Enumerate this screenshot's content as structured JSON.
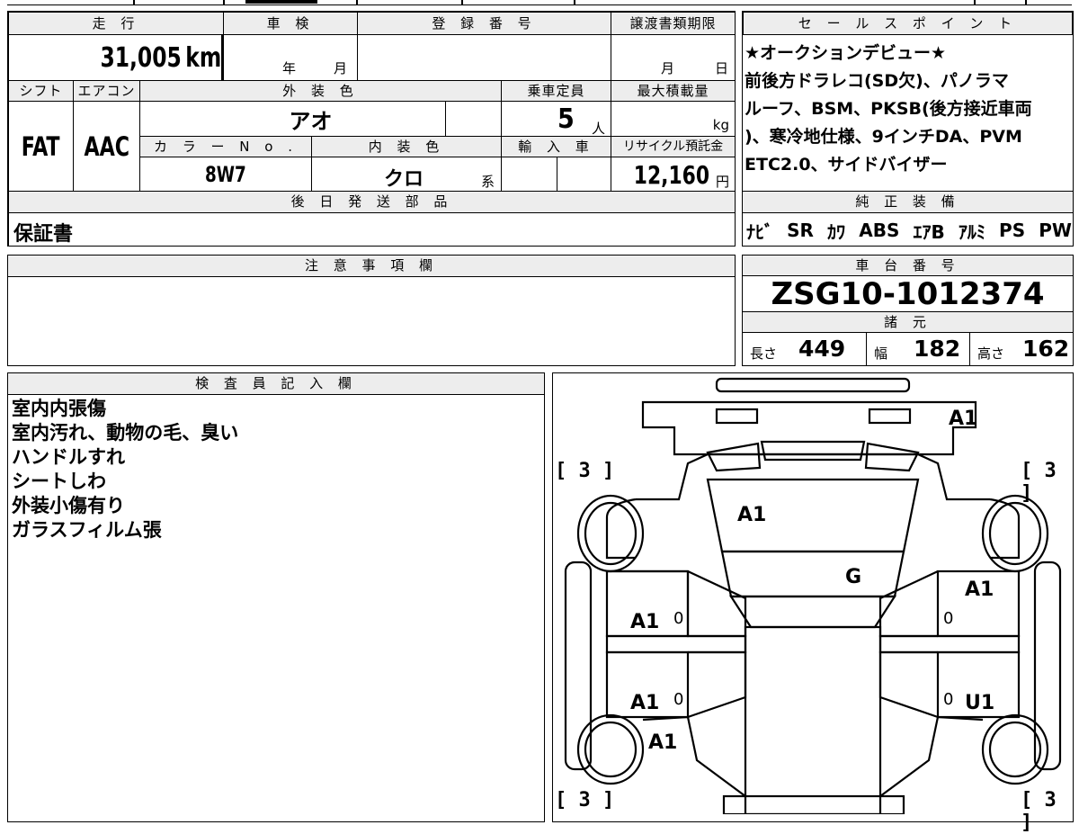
{
  "vehicle": {
    "mileage_header": "走 行",
    "mileage": "31,005",
    "mileage_unit": "km",
    "inspection_header": "車 検",
    "inspection_year_label": "年",
    "inspection_month_label": "月",
    "registration_header": "登 録 番 号",
    "transfer_header": "譲渡書類期限",
    "transfer_month_label": "月",
    "transfer_day_label": "日",
    "shift_header": "シフト",
    "shift": "FAT",
    "ac_header": "エアコン",
    "ac": "AAC",
    "exterior_color_header": "外 装 色",
    "exterior_color": "アオ",
    "capacity_header": "乗車定員",
    "capacity": "5",
    "capacity_unit": "人",
    "max_load_header": "最大積載量",
    "max_load_unit": "kg",
    "color_no_header": "カ ラ ー N o .",
    "color_no": "8W7",
    "interior_color_header": "内 装 色",
    "interior_color": "クロ",
    "interior_suffix": "系",
    "import_header": "輸 入 車",
    "recycle_header": "リサイクル預託金",
    "recycle_fee": "12,160",
    "recycle_unit": "円",
    "parts_header": "後 日 発 送 部 品",
    "parts": "保証書"
  },
  "sales_points": {
    "header": "セ ー ル ス ポ イ ン ト",
    "lines": [
      "★オークションデビュー★",
      "前後方ドラレコ(SD欠)、パノラマ",
      "ルーフ、BSM、PKSB(後方接近車両",
      ")、寒冷地仕様、9インチDA、PVM",
      "ETC2.0、サイドバイザー"
    ]
  },
  "equipment": {
    "header": "純 正 装 備",
    "items": [
      "ﾅﾋﾞ",
      "SR",
      "ｶﾜ",
      "ABS",
      "ｴｱB",
      "ｱﾙﾐ",
      "PS",
      "PW"
    ]
  },
  "notes": {
    "header": "注 意 事 項 欄"
  },
  "chassis": {
    "header": "車 台 番 号",
    "number": "ZSG10-1012374",
    "spec_header": "諸 元",
    "length_label": "長さ",
    "length": "449",
    "width_label": "幅",
    "width": "182",
    "height_label": "高さ",
    "height": "162"
  },
  "inspector": {
    "header": "検 査 員 記 入 欄",
    "remarks": [
      "室内内張傷",
      "室内汚れ、動物の毛、臭い",
      "ハンドルすれ",
      "シートしわ",
      "外装小傷有り",
      "ガラスフィルム張"
    ]
  },
  "diagram": {
    "tire_tl": "[ 3 ]",
    "tire_tr": "[ 3 ]",
    "tire_bl": "[ 3 ]",
    "tire_br": "[ 3 ]",
    "mark_rear": "A1",
    "mark_roof": "A1",
    "mark_glass": "G",
    "mark_right_front_door": "A1",
    "mark_left_front_door": "A1",
    "mark_left_rear_door": "A1",
    "mark_right_rear_door": "U1",
    "mark_left_front_fender": "A1",
    "zero_1": "0",
    "zero_2": "0",
    "zero_3": "0",
    "zero_4": "0"
  }
}
